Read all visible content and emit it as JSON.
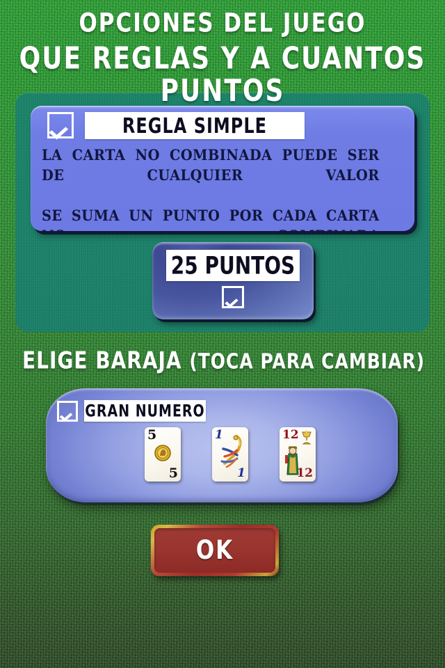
{
  "screen": {
    "title_line1": "OPCIONES DEL JUEGO",
    "title_line2": "QUE REGLAS Y A CUANTOS PUNTOS",
    "background_color": "#2d7a2c",
    "panel_color": "#168075"
  },
  "rule_option": {
    "name": "REGLA SIMPLE",
    "checked_icon": "checkmark-icon",
    "checked": true,
    "description_line1": "LA CARTA NO COMBINADA PUEDE SER DE CUALQUIER VALOR",
    "description_line2": "SE SUMA UN PUNTO POR CADA CARTA NO COMBINADA",
    "panel_color": "#6d7ae3",
    "text_color": "#11163f"
  },
  "points_option": {
    "label": "25 PUNTOS",
    "value": "25",
    "checked_icon": "checkmark-icon",
    "checked": true
  },
  "deck_section": {
    "heading": "ELIGE BARAJA",
    "hint": "(TOCA PARA CAMBIAR)",
    "deck_name": "GRAN NUMERO",
    "checked_icon": "checkmark-icon",
    "checked": true,
    "cards": [
      {
        "rank": "5",
        "suit": "oros",
        "suit_icon": "coin-icon",
        "color": "#111111"
      },
      {
        "rank": "1",
        "suit": "bastos",
        "suit_icon": "club-icon",
        "color": "#1b2f95"
      },
      {
        "rank": "12",
        "suit": "copas",
        "suit_icon": "cup-icon",
        "color": "#8f1320"
      }
    ]
  },
  "footer": {
    "ok_label": "OK",
    "ok_color": "#9a352f",
    "ok_border_color": "#c9a227"
  }
}
